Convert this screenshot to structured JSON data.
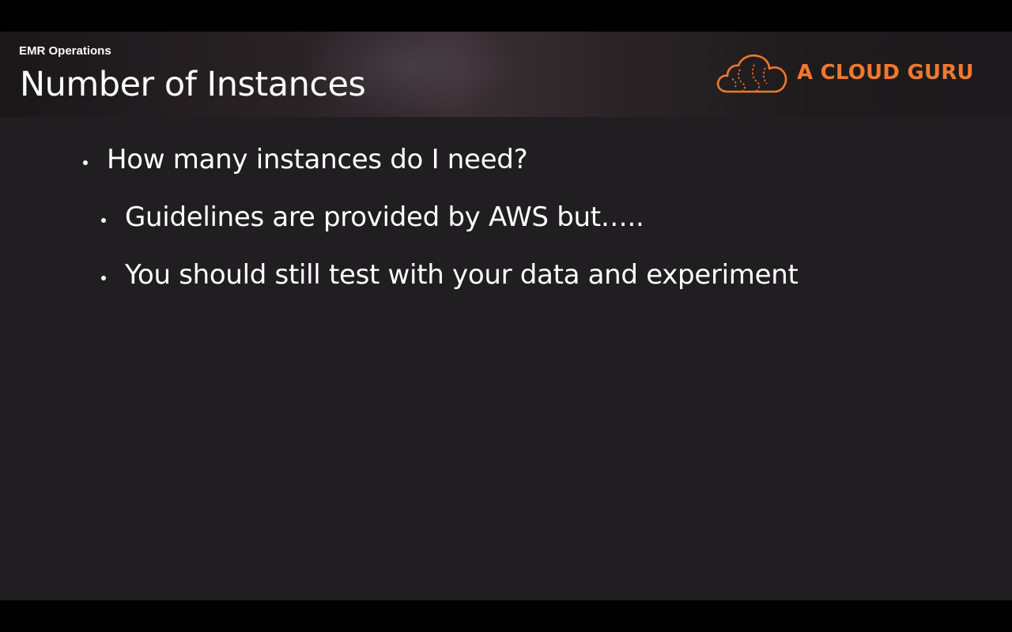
{
  "header": {
    "section_label": "EMR Operations",
    "title": "Number of Instances"
  },
  "logo": {
    "text": "A CLOUD GURU",
    "icon": "cloud-logo-icon",
    "accent_color": "#f0782d"
  },
  "bullets": [
    {
      "level": 1,
      "text": "How many instances do I need?"
    },
    {
      "level": 2,
      "text": "Guidelines are provided by AWS but….."
    },
    {
      "level": 2,
      "text": "You should still test with your data and experiment"
    }
  ],
  "colors": {
    "background": "#201e21",
    "text": "#ffffff",
    "accent": "#f0782d"
  }
}
